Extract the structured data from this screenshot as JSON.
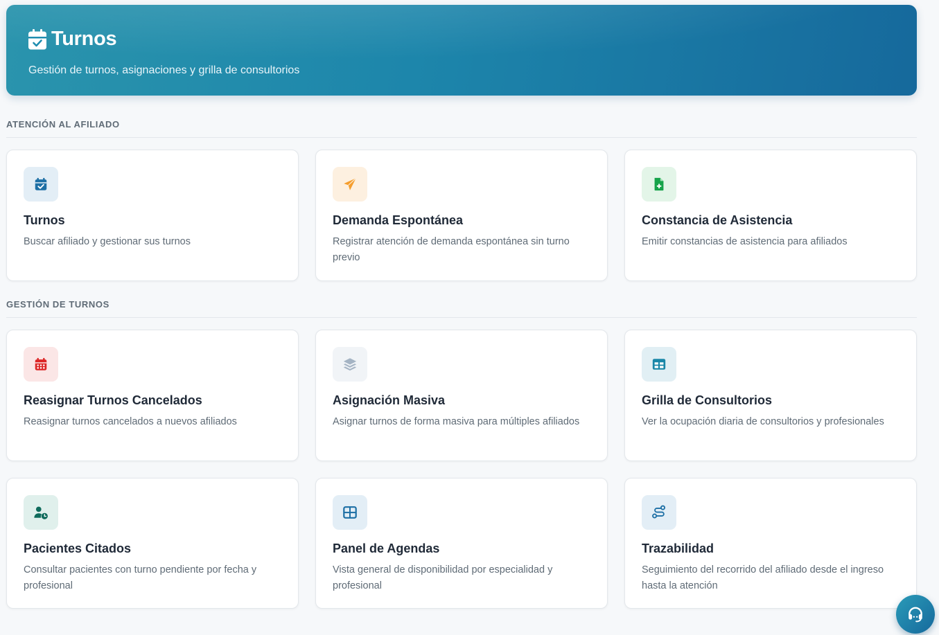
{
  "header": {
    "title": "Turnos",
    "subtitle": "Gestión de turnos, asignaciones y grilla de consultorios",
    "icon": "calendar-check-icon"
  },
  "sections": [
    {
      "label": "ATENCIÓN AL AFILIADO",
      "cards": [
        {
          "title": "Turnos",
          "description": "Buscar afiliado y gestionar sus turnos",
          "icon": "calendar-check-icon",
          "color": "#1d6fa5",
          "bg": "#e3eef6"
        },
        {
          "title": "Demanda Espontánea",
          "description": "Registrar atención de demanda espontánea sin turno previo",
          "icon": "paper-plane-icon",
          "color": "#f59e2e",
          "bg": "#fdf0e0"
        },
        {
          "title": "Constancia de Asistencia",
          "description": "Emitir constancias de asistencia para afiliados",
          "icon": "file-medical-icon",
          "color": "#16a34a",
          "bg": "#e3f5e8"
        }
      ]
    },
    {
      "label": "GESTIÓN DE TURNOS",
      "cards": [
        {
          "title": "Reasignar Turnos Cancelados",
          "description": "Reasignar turnos cancelados a nuevos afiliados",
          "icon": "calendar-grid-icon",
          "color": "#dc2626",
          "bg": "#fbe6e6"
        },
        {
          "title": "Asignación Masiva",
          "description": "Asignar turnos de forma masiva para múltiples afiliados",
          "icon": "layers-icon",
          "color": "#a5b4c4",
          "bg": "#f1f4f7"
        },
        {
          "title": "Grilla de Consultorios",
          "description": "Ver la ocupación diaria de consultorios y profesionales",
          "icon": "table-icon",
          "color": "#1a87a8",
          "bg": "#e1eff4"
        },
        {
          "title": "Pacientes Citados",
          "description": "Consultar pacientes con turno pendiente por fecha y profesional",
          "icon": "user-clock-icon",
          "color": "#0f6b5c",
          "bg": "#e0f0ec"
        },
        {
          "title": "Panel de Agendas",
          "description": "Vista general de disponibilidad por especialidad y profesional",
          "icon": "table-cells-icon",
          "color": "#1d6fa5",
          "bg": "#e3eef6"
        },
        {
          "title": "Trazabilidad",
          "description": "Seguimiento del recorrido del afiliado desde el ingreso hasta la atención",
          "icon": "route-icon",
          "color": "#1d6fa5",
          "bg": "#e3eef6"
        }
      ]
    }
  ],
  "help_button": {
    "icon": "headset-icon"
  }
}
